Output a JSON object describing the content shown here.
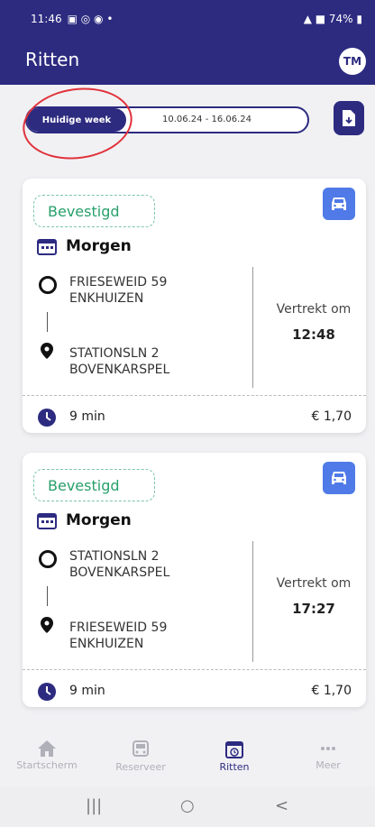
{
  "status_bar": {
    "time": "11:46",
    "battery": "74%"
  },
  "header": {
    "title": "Ritten",
    "avatar_initials": "TM"
  },
  "week_selector": {
    "current_label": "Huidige week",
    "range": "10.06.24 - 16.06.24"
  },
  "rides": [
    {
      "status": "Bevestigd",
      "day": "Morgen",
      "from_line1": "FRIESEWEID 59",
      "from_line2": "ENKHUIZEN",
      "to_line1": "STATIONSLN 2",
      "to_line2": "BOVENKARSPEL",
      "departure_label": "Vertrekt om",
      "departure_time": "12:48",
      "duration": "9 min",
      "price": "€ 1,70"
    },
    {
      "status": "Bevestigd",
      "day": "Morgen",
      "from_line1": "STATIONSLN 2",
      "from_line2": "BOVENKARSPEL",
      "to_line1": "FRIESEWEID 59",
      "to_line2": "ENKHUIZEN",
      "departure_label": "Vertrekt om",
      "departure_time": "17:27",
      "duration": "9 min",
      "price": "€ 1,70"
    }
  ],
  "bottom_nav": [
    {
      "label": "Startscherm",
      "icon": "home-icon"
    },
    {
      "label": "Reserveer",
      "icon": "bus-icon"
    },
    {
      "label": "Ritten",
      "icon": "calendar-clock-icon"
    },
    {
      "label": "Meer",
      "icon": "more-icon"
    }
  ],
  "system_nav": {
    "recents": "|||",
    "home": "○",
    "back": "<"
  },
  "colors": {
    "primary": "#2d2b80",
    "confirmed": "#27a06b",
    "accent_blue": "#4f7ae7",
    "annotation_red": "#e0323a"
  }
}
